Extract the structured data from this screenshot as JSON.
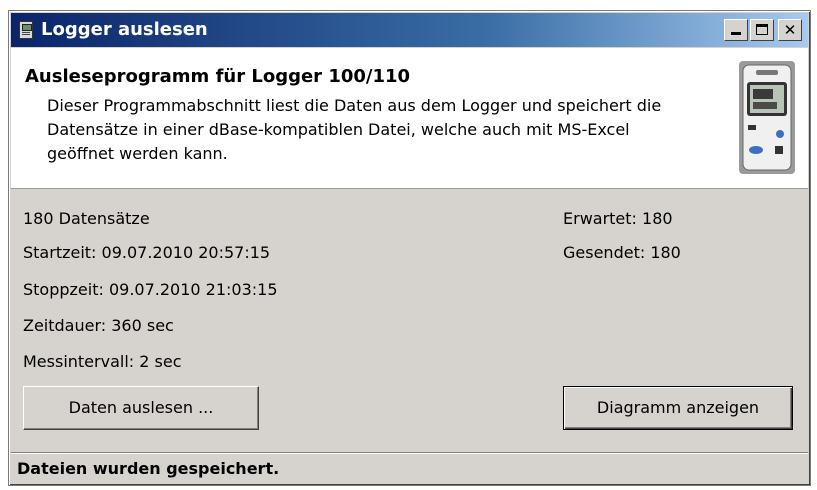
{
  "window": {
    "title": "Logger auslesen"
  },
  "header": {
    "title": "Ausleseprogramm für Logger 100/110",
    "description": "Dieser Programmabschnitt liest die Daten aus dem Logger und speichert die Datensätze in einer dBase-kompatiblen Datei, welche auch mit MS-Excel geöffnet werden kann."
  },
  "info": {
    "records": "180 Datensätze",
    "start": "Startzeit: 09.07.2010 20:57:15",
    "stop": "Stoppzeit: 09.07.2010 21:03:15",
    "duration": "Zeitdauer: 360 sec",
    "interval": "Messintervall: 2 sec",
    "expected": "Erwartet: 180",
    "sent": "Gesendet: 180"
  },
  "buttons": {
    "read": "Daten auslesen ...",
    "chart": "Diagramm anzeigen"
  },
  "status": {
    "text": "Dateien wurden gespeichert."
  }
}
